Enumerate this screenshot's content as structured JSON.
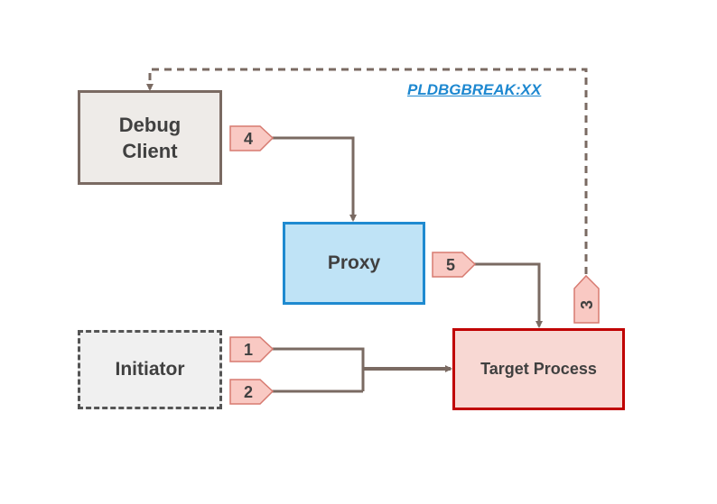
{
  "diagram": {
    "nodes": {
      "debug_client": "Debug\nClient",
      "proxy": "Proxy",
      "initiator": "Initiator",
      "target_process": "Target Process"
    },
    "link_label": "PLDBGBREAK:XX",
    "steps": [
      "1",
      "2",
      "3",
      "4",
      "5"
    ],
    "colors": {
      "connector": "#7a6a62",
      "flag_fill": "#f9c9c3",
      "flag_stroke": "#d77a70",
      "link": "#1e88d0",
      "target_border": "#c00000",
      "proxy_border": "#1f8ad0"
    }
  }
}
